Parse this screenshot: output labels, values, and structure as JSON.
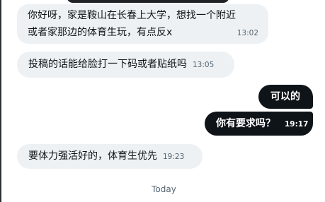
{
  "messages": [
    {
      "direction": "incoming",
      "lines": [
        "你好呀，家是鞍山在长春上大学，想找一个附近",
        "或者家那边的体育生玩，有点反x"
      ],
      "time": "13:02"
    },
    {
      "direction": "incoming",
      "text": "投稿的话能给脸打一下码或者贴纸吗",
      "time": "13:05"
    },
    {
      "direction": "outgoing",
      "text": "可以的"
    },
    {
      "direction": "outgoing",
      "text": "你有要求吗？",
      "time": "19:17"
    },
    {
      "direction": "incoming",
      "text": "要体力强活好的，体育生优先",
      "time": "19:23"
    }
  ],
  "divider": {
    "label": "Today"
  },
  "colors": {
    "incoming_bubble": "#eef1f3",
    "outgoing_bubble": "#0f1419",
    "timestamp": "#536471"
  }
}
